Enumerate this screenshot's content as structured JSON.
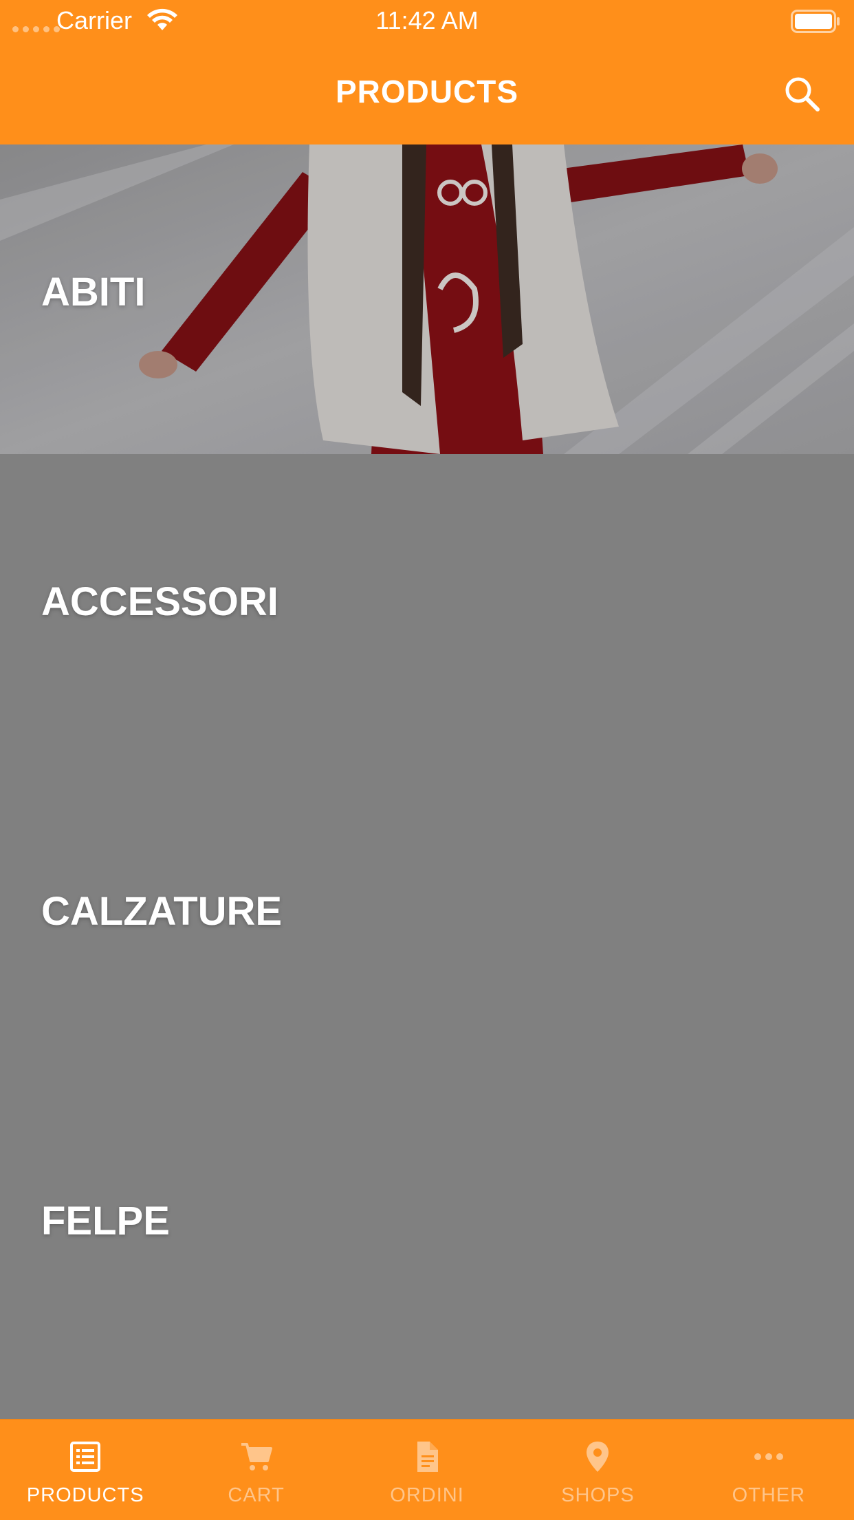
{
  "status_bar": {
    "carrier": "Carrier",
    "time": "11:42 AM"
  },
  "header": {
    "title": "PRODUCTS",
    "search_icon": "search-icon",
    "background_color": "#FF8F1A"
  },
  "categories": [
    {
      "label": "ABITI",
      "has_photo": true
    },
    {
      "label": "ACCESSORI",
      "has_photo": false
    },
    {
      "label": "CALZATURE",
      "has_photo": false
    },
    {
      "label": "FELPE",
      "has_photo": false
    }
  ],
  "tab_bar": {
    "active_color": "#FFFFFF",
    "inactive_color": "#FFC58A",
    "tabs": [
      {
        "label": "PRODUCTS",
        "icon": "list-icon",
        "active": true
      },
      {
        "label": "CART",
        "icon": "cart-icon",
        "active": false
      },
      {
        "label": "ORDINI",
        "icon": "document-icon",
        "active": false
      },
      {
        "label": "SHOPS",
        "icon": "map-pin-icon",
        "active": false
      },
      {
        "label": "OTHER",
        "icon": "more-icon",
        "active": false
      }
    ]
  }
}
